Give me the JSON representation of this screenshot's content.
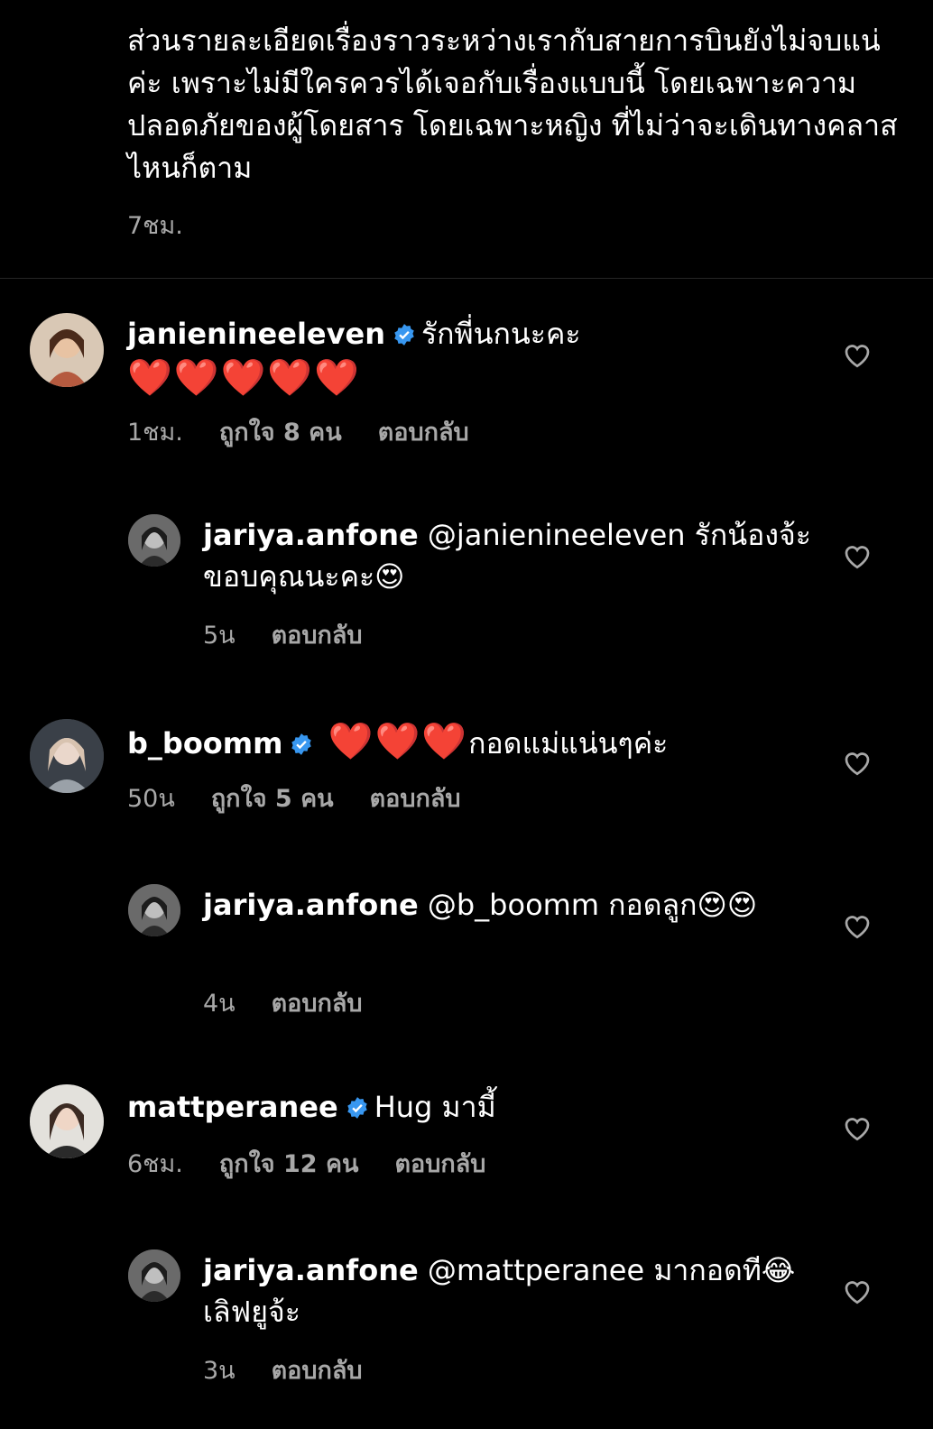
{
  "caption": {
    "text": "ส่วนรายละเอียดเรื่องราวระหว่างเรากับสายการบินยังไม่จบแน่ค่ะ เพราะไม่มีใครควรได้เจอกับเรื่องแบบนี้ โดยเฉพาะความปลอดภัยของผู้โดยสาร โดยเฉพาะหญิง  ที่ไม่ว่าจะเดินทางคลาสไหนก็ตาม",
    "time": "7ชม."
  },
  "comments": [
    {
      "username": "janienineeleven",
      "text": "รักพี่นกนะคะ",
      "hearts": "❤️❤️❤️❤️❤️",
      "time": "1ชม.",
      "likes": "ถูกใจ 8 คน",
      "reply_label": "ตอบกลับ"
    },
    {
      "username": "jariya.anfone",
      "text": "@janienineeleven รักน้องจ้ะขอบคุณนะคะ😍",
      "time": "5น",
      "reply_label": "ตอบกลับ"
    },
    {
      "username": "b_boomm",
      "hearts": "❤️❤️❤️",
      "text": "กอดแม่แน่นๆค่ะ",
      "time": "50น",
      "likes": "ถูกใจ 5 คน",
      "reply_label": "ตอบกลับ"
    },
    {
      "username": "jariya.anfone",
      "text": "@b_boomm กอดลูก😍😍",
      "time": "4น",
      "reply_label": "ตอบกลับ"
    },
    {
      "username": "mattperanee",
      "text": "Hug มามี้",
      "time": "6ชม.",
      "likes": "ถูกใจ 12 คน",
      "reply_label": "ตอบกลับ"
    },
    {
      "username": "jariya.anfone",
      "text": "@mattperanee มากอดที😂เลิฟยูจ้ะ",
      "time": "3น",
      "reply_label": "ตอบกลับ"
    }
  ],
  "colors": {
    "background": "#000000",
    "secondary_text": "#a8a8a8",
    "verified_badge": "#3897f0",
    "divider": "#262626"
  },
  "icons": [
    "verified-badge-icon",
    "heart-outline-icon",
    "avatar"
  ]
}
